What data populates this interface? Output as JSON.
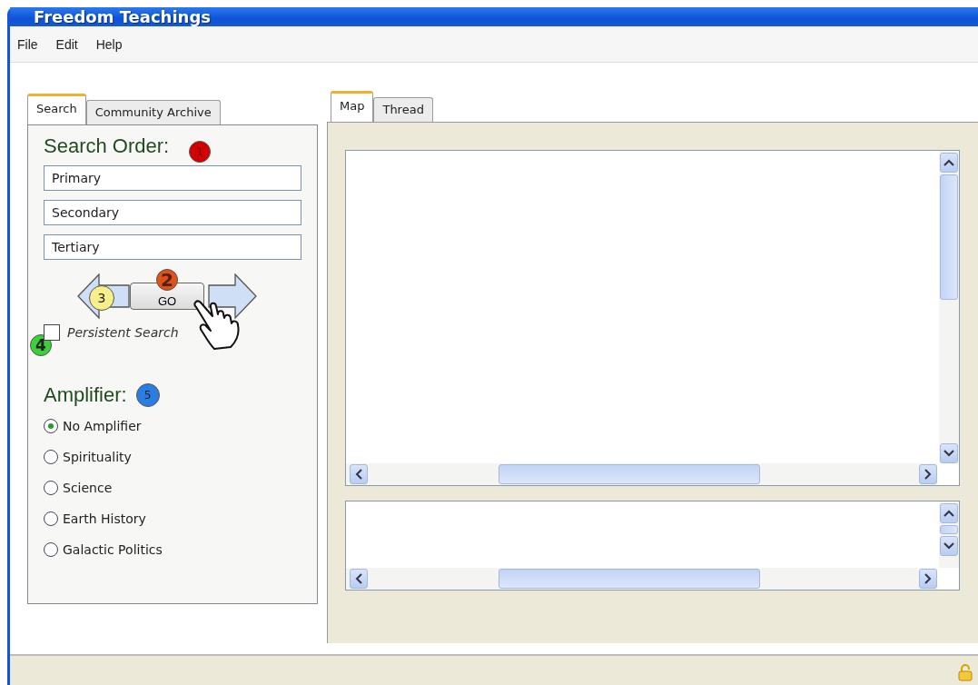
{
  "window": {
    "title": "Freedom Teachings"
  },
  "menu": [
    "File",
    "Edit",
    "Help"
  ],
  "left_tabs": [
    {
      "label": "Search",
      "selected": true
    },
    {
      "label": "Community Archive",
      "selected": false
    }
  ],
  "search_order": {
    "heading": "Search Order:",
    "badge": {
      "label": "1",
      "color": "#d40000"
    },
    "fields": [
      {
        "value": "Primary"
      },
      {
        "value": "Secondary"
      },
      {
        "value": "Tertiary"
      }
    ]
  },
  "navigation": {
    "go_label": "GO",
    "go_badge": {
      "label": "2",
      "color": "#e0521a"
    },
    "back_badge": {
      "label": "3",
      "color": "#f7ef8a"
    }
  },
  "persistent_search": {
    "label": "Persistent Search",
    "checked": false,
    "badge": {
      "label": "4",
      "color": "#3ccf3c"
    }
  },
  "amplifier": {
    "heading": "Amplifier:",
    "badge": {
      "label": "5",
      "color": "#2a7de1"
    },
    "options": [
      {
        "label": "No Amplifier",
        "selected": true
      },
      {
        "label": "Spirituality",
        "selected": false
      },
      {
        "label": "Science",
        "selected": false
      },
      {
        "label": "Earth History",
        "selected": false
      },
      {
        "label": "Galactic Politics",
        "selected": false
      }
    ]
  },
  "right_tabs": [
    {
      "label": "Map",
      "selected": true
    },
    {
      "label": "Thread",
      "selected": false
    }
  ]
}
